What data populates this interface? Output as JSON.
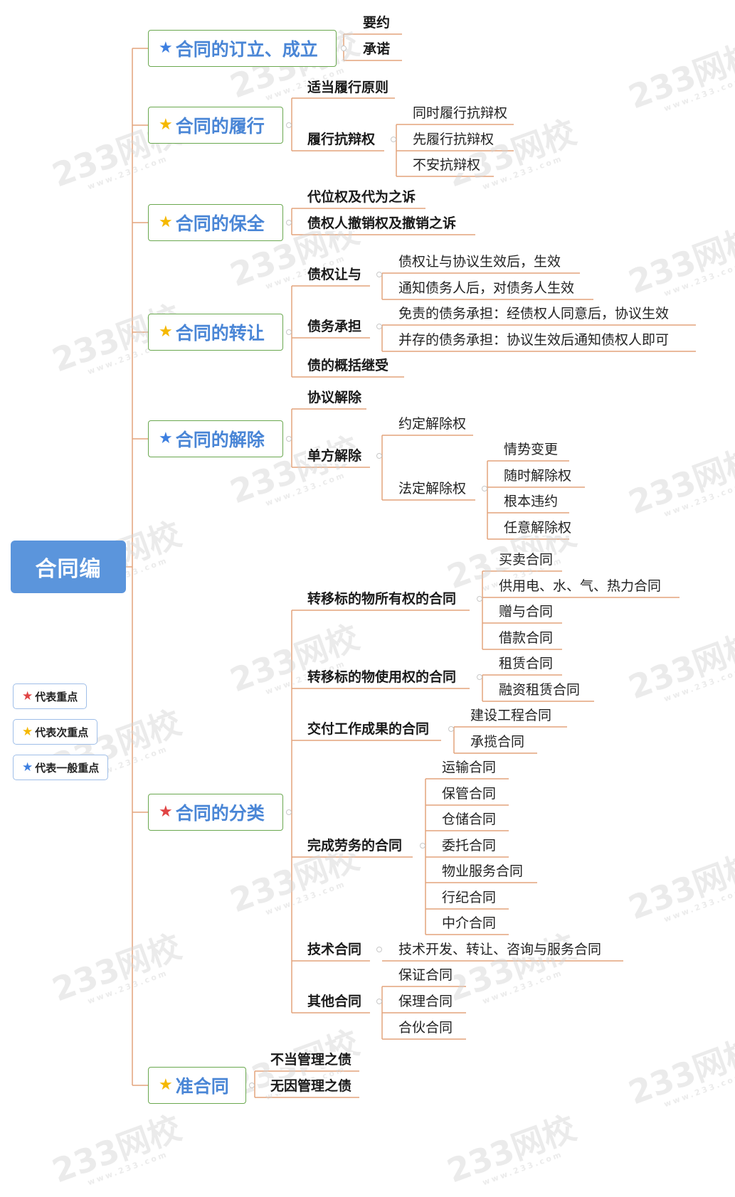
{
  "colors": {
    "connector": "#e3a47c",
    "root_bg": "#5b95dc",
    "l1_border": "#6aa84f",
    "l1_text": "#4a86d6",
    "star_red": "#e04444",
    "star_yellow": "#f5b800",
    "star_blue": "#3d7fe0"
  },
  "root": "合同编",
  "sections": [
    {
      "label": "合同的订立、成立",
      "star": "blue"
    },
    {
      "label": "合同的履行",
      "star": "yellow"
    },
    {
      "label": "合同的保全",
      "star": "yellow"
    },
    {
      "label": "合同的转让",
      "star": "yellow"
    },
    {
      "label": "合同的解除",
      "star": "blue"
    },
    {
      "label": "合同的分类",
      "star": "red"
    },
    {
      "label": "准合同",
      "star": "yellow"
    }
  ],
  "nodes": {
    "yaoyue": "要约",
    "chengnuo": "承诺",
    "shidang": "适当履行原则",
    "lvxing_kbq": "履行抗辩权",
    "tongshi": "同时履行抗辩权",
    "xian": "先履行抗辩权",
    "buan": "不安抗辩权",
    "daiwei": "代位权及代为之诉",
    "chexiao": "债权人撤销权及撤销之诉",
    "zq_rangyu": "债权让与",
    "zq_r1": "债权让与协议生效后，生效",
    "zq_r2": "通知债务人后，对债务人生效",
    "zw_chengdan": "债务承担",
    "zw_c1": "免责的债务承担：经债权人同意后，协议生效",
    "zw_c2": "并存的债务承担：协议生效后通知债权人即可",
    "gaikuo": "债的概括继受",
    "xieyi_jc": "协议解除",
    "danfang_jc": "单方解除",
    "yueding": "约定解除权",
    "fading": "法定解除权",
    "qingshi": "情势变更",
    "suishi": "随时解除权",
    "genben": "根本违约",
    "renyi": "任意解除权",
    "zhuanyi_suoyou": "转移标的物所有权的合同",
    "maimai": "买卖合同",
    "gongyong": "供用电、水、气、热力合同",
    "zengyu": "赠与合同",
    "jiekuan": "借款合同",
    "zhuanyi_shiyong": "转移标的物使用权的合同",
    "zulin": "租赁合同",
    "rongzi": "融资租赁合同",
    "jiaofu": "交付工作成果的合同",
    "jianshe": "建设工程合同",
    "chenglan": "承揽合同",
    "laowu": "完成劳务的合同",
    "yunshu": "运输合同",
    "baoguan": "保管合同",
    "cangchu": "仓储合同",
    "weituo": "委托合同",
    "wuye": "物业服务合同",
    "hangji": "行纪合同",
    "zhongjie": "中介合同",
    "jishu": "技术合同",
    "jishu_sub": "技术开发、转让、咨询与服务合同",
    "qita": "其他合同",
    "baozheng": "保证合同",
    "baoli": "保理合同",
    "hehuo": "合伙合同",
    "budang": "不当管理之债",
    "wuyin": "无因管理之债"
  },
  "legend": [
    {
      "label": "代表重点",
      "star": "red"
    },
    {
      "label": "代表次重点",
      "star": "yellow"
    },
    {
      "label": "代表一般重点",
      "star": "blue"
    }
  ],
  "watermark": {
    "brand": "233网校",
    "site": "www.233.com"
  },
  "icons": {
    "star": "star-icon",
    "collapse": "collapse-dot-icon"
  }
}
